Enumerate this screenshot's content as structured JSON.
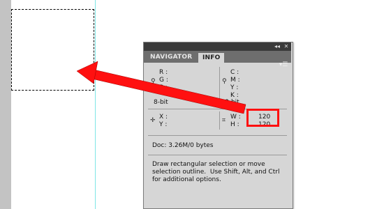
{
  "panel": {
    "collapse_glyph": "◂◂",
    "close_glyph": "✕",
    "tabs": [
      {
        "label": "NAVIGATOR",
        "active": false
      },
      {
        "label": "INFO",
        "active": true
      }
    ],
    "menu_icon": "panel-menu-icon"
  },
  "info": {
    "rgb": {
      "r": "R :",
      "g": "G :",
      "b": "B :",
      "bit": "8-bit"
    },
    "cmyk": {
      "c": "C :",
      "m": "M :",
      "y": "Y :",
      "k": "K :",
      "bit": "8-bit"
    },
    "pos": {
      "x": "X :",
      "y": "Y :"
    },
    "size": {
      "w": "W :",
      "h": "H :",
      "w_val": "120",
      "h_val": "120"
    },
    "doc": "Doc: 3.26M/0 bytes",
    "hint_lines": [
      "Draw rectangular selection or move",
      "selection outline.  Use Shift, Alt, and Ctrl",
      "for additional options."
    ]
  },
  "colors": {
    "annotation": "#ff1010",
    "guide": "#7fe6e6",
    "panel_bg": "#d6d6d6"
  }
}
